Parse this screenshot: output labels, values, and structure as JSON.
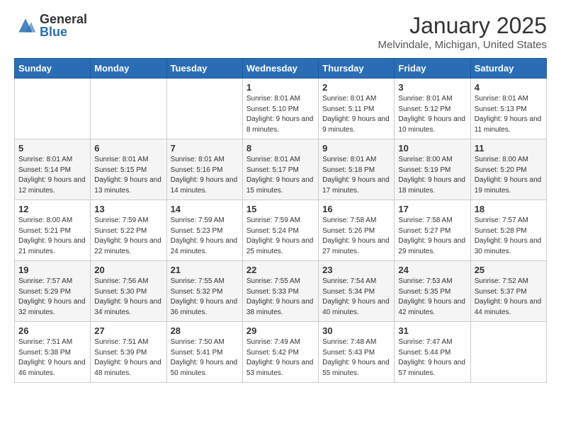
{
  "logo": {
    "general": "General",
    "blue": "Blue"
  },
  "title": "January 2025",
  "location": "Melvindale, Michigan, United States",
  "weekdays": [
    "Sunday",
    "Monday",
    "Tuesday",
    "Wednesday",
    "Thursday",
    "Friday",
    "Saturday"
  ],
  "weeks": [
    [
      {
        "day": "",
        "content": ""
      },
      {
        "day": "",
        "content": ""
      },
      {
        "day": "",
        "content": ""
      },
      {
        "day": "1",
        "content": "Sunrise: 8:01 AM\nSunset: 5:10 PM\nDaylight: 9 hours and 8 minutes."
      },
      {
        "day": "2",
        "content": "Sunrise: 8:01 AM\nSunset: 5:11 PM\nDaylight: 9 hours and 9 minutes."
      },
      {
        "day": "3",
        "content": "Sunrise: 8:01 AM\nSunset: 5:12 PM\nDaylight: 9 hours and 10 minutes."
      },
      {
        "day": "4",
        "content": "Sunrise: 8:01 AM\nSunset: 5:13 PM\nDaylight: 9 hours and 11 minutes."
      }
    ],
    [
      {
        "day": "5",
        "content": "Sunrise: 8:01 AM\nSunset: 5:14 PM\nDaylight: 9 hours and 12 minutes."
      },
      {
        "day": "6",
        "content": "Sunrise: 8:01 AM\nSunset: 5:15 PM\nDaylight: 9 hours and 13 minutes."
      },
      {
        "day": "7",
        "content": "Sunrise: 8:01 AM\nSunset: 5:16 PM\nDaylight: 9 hours and 14 minutes."
      },
      {
        "day": "8",
        "content": "Sunrise: 8:01 AM\nSunset: 5:17 PM\nDaylight: 9 hours and 15 minutes."
      },
      {
        "day": "9",
        "content": "Sunrise: 8:01 AM\nSunset: 5:18 PM\nDaylight: 9 hours and 17 minutes."
      },
      {
        "day": "10",
        "content": "Sunrise: 8:00 AM\nSunset: 5:19 PM\nDaylight: 9 hours and 18 minutes."
      },
      {
        "day": "11",
        "content": "Sunrise: 8:00 AM\nSunset: 5:20 PM\nDaylight: 9 hours and 19 minutes."
      }
    ],
    [
      {
        "day": "12",
        "content": "Sunrise: 8:00 AM\nSunset: 5:21 PM\nDaylight: 9 hours and 21 minutes."
      },
      {
        "day": "13",
        "content": "Sunrise: 7:59 AM\nSunset: 5:22 PM\nDaylight: 9 hours and 22 minutes."
      },
      {
        "day": "14",
        "content": "Sunrise: 7:59 AM\nSunset: 5:23 PM\nDaylight: 9 hours and 24 minutes."
      },
      {
        "day": "15",
        "content": "Sunrise: 7:59 AM\nSunset: 5:24 PM\nDaylight: 9 hours and 25 minutes."
      },
      {
        "day": "16",
        "content": "Sunrise: 7:58 AM\nSunset: 5:26 PM\nDaylight: 9 hours and 27 minutes."
      },
      {
        "day": "17",
        "content": "Sunrise: 7:58 AM\nSunset: 5:27 PM\nDaylight: 9 hours and 29 minutes."
      },
      {
        "day": "18",
        "content": "Sunrise: 7:57 AM\nSunset: 5:28 PM\nDaylight: 9 hours and 30 minutes."
      }
    ],
    [
      {
        "day": "19",
        "content": "Sunrise: 7:57 AM\nSunset: 5:29 PM\nDaylight: 9 hours and 32 minutes."
      },
      {
        "day": "20",
        "content": "Sunrise: 7:56 AM\nSunset: 5:30 PM\nDaylight: 9 hours and 34 minutes."
      },
      {
        "day": "21",
        "content": "Sunrise: 7:55 AM\nSunset: 5:32 PM\nDaylight: 9 hours and 36 minutes."
      },
      {
        "day": "22",
        "content": "Sunrise: 7:55 AM\nSunset: 5:33 PM\nDaylight: 9 hours and 38 minutes."
      },
      {
        "day": "23",
        "content": "Sunrise: 7:54 AM\nSunset: 5:34 PM\nDaylight: 9 hours and 40 minutes."
      },
      {
        "day": "24",
        "content": "Sunrise: 7:53 AM\nSunset: 5:35 PM\nDaylight: 9 hours and 42 minutes."
      },
      {
        "day": "25",
        "content": "Sunrise: 7:52 AM\nSunset: 5:37 PM\nDaylight: 9 hours and 44 minutes."
      }
    ],
    [
      {
        "day": "26",
        "content": "Sunrise: 7:51 AM\nSunset: 5:38 PM\nDaylight: 9 hours and 46 minutes."
      },
      {
        "day": "27",
        "content": "Sunrise: 7:51 AM\nSunset: 5:39 PM\nDaylight: 9 hours and 48 minutes."
      },
      {
        "day": "28",
        "content": "Sunrise: 7:50 AM\nSunset: 5:41 PM\nDaylight: 9 hours and 50 minutes."
      },
      {
        "day": "29",
        "content": "Sunrise: 7:49 AM\nSunset: 5:42 PM\nDaylight: 9 hours and 53 minutes."
      },
      {
        "day": "30",
        "content": "Sunrise: 7:48 AM\nSunset: 5:43 PM\nDaylight: 9 hours and 55 minutes."
      },
      {
        "day": "31",
        "content": "Sunrise: 7:47 AM\nSunset: 5:44 PM\nDaylight: 9 hours and 57 minutes."
      },
      {
        "day": "",
        "content": ""
      }
    ]
  ]
}
